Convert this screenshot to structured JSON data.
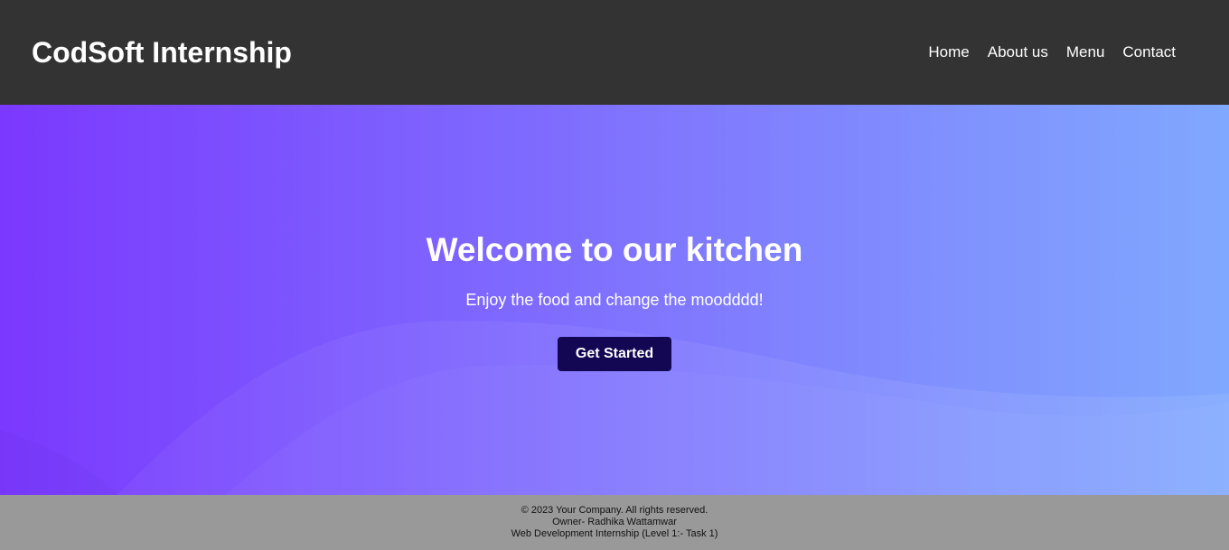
{
  "header": {
    "brand": "CodSoft Internship",
    "nav": [
      {
        "label": "Home"
      },
      {
        "label": "About us"
      },
      {
        "label": "Menu"
      },
      {
        "label": "Contact"
      }
    ]
  },
  "hero": {
    "title": "Welcome to our kitchen",
    "subtitle": "Enjoy the food and change the moodddd!",
    "cta_label": "Get Started"
  },
  "footer": {
    "copyright": "© 2023 Your Company. All rights reserved.",
    "owner": "Owner- Radhika Wattamwar",
    "program": "Web Development Internship (Level 1:- Task 1)"
  },
  "colors": {
    "header_bg": "#333333",
    "hero_gradient_start": "#7b38fe",
    "hero_gradient_end": "#80a8fe",
    "cta_bg": "#130652",
    "footer_bg": "#999999"
  }
}
